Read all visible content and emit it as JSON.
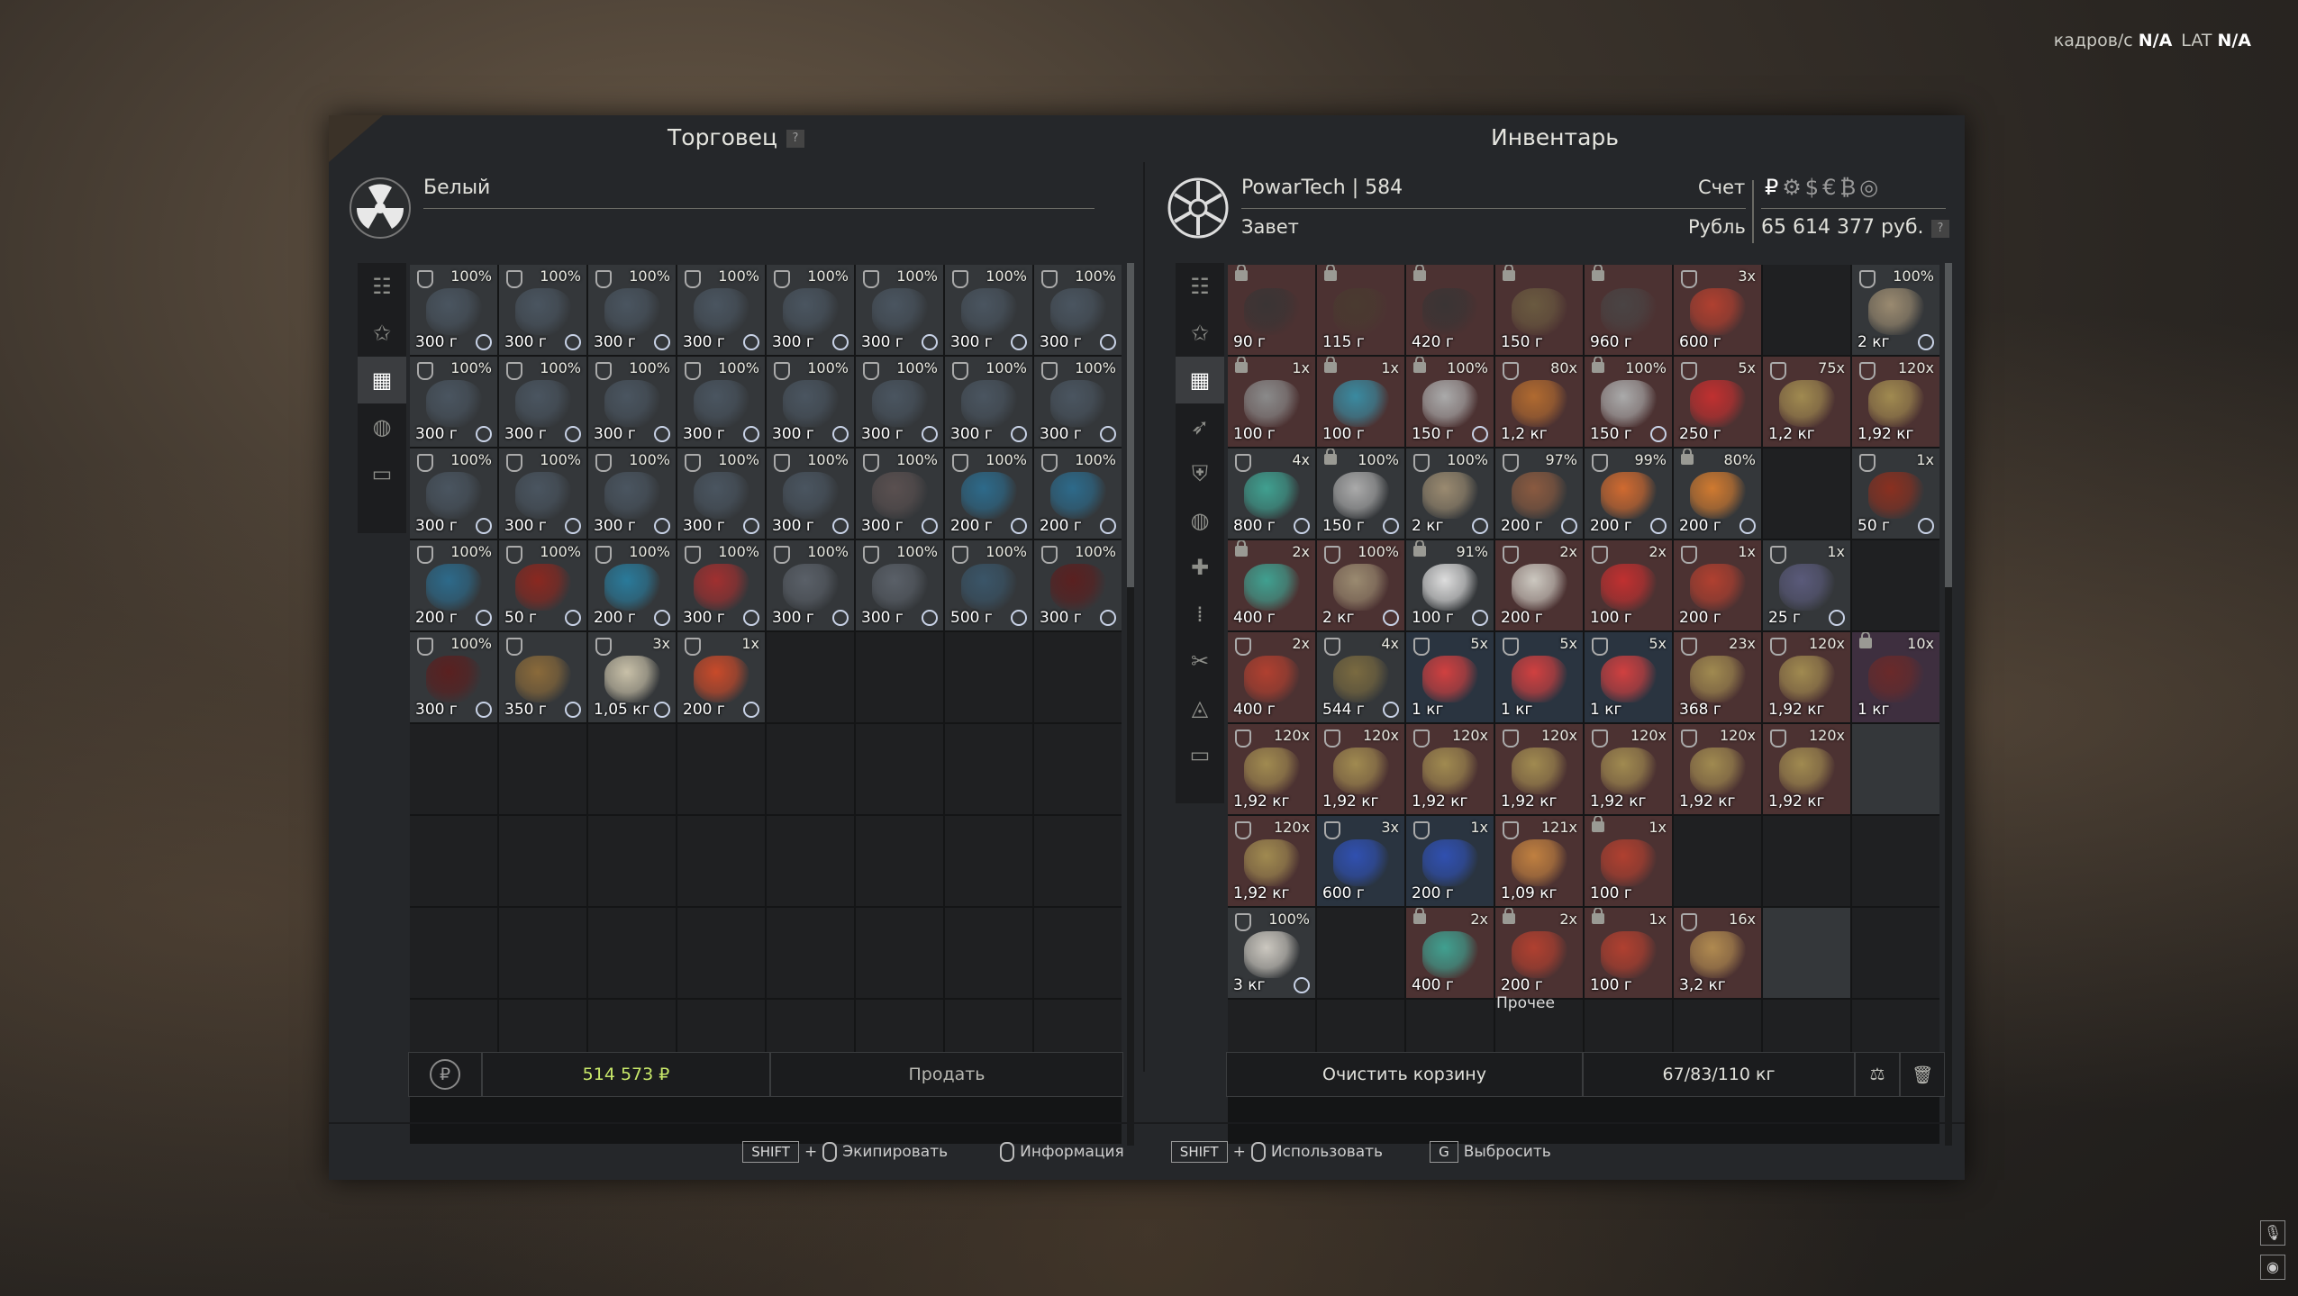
{
  "hud": {
    "fps_label": "кадров/с",
    "fps_value": "N/A",
    "lat_label": "LAT",
    "lat_value": "N/A"
  },
  "trader_panel": {
    "title": "Торговец",
    "help": "?",
    "trader_name": "Белый",
    "price_total": "514 573 ₽",
    "sell_label": "Продать"
  },
  "inventory_panel": {
    "title": "Инвентарь",
    "player": "PowarTech | 584",
    "faction": "Завет",
    "account_label": "Счет",
    "currency_name": "Рубль",
    "balance": "65 614 377 руб.",
    "help": "?",
    "clear_cart_label": "Очистить корзину",
    "weight": "67/83/110 кг",
    "misc_label": "Прочее"
  },
  "footer": {
    "equip_key": "SHIFT",
    "equip_label": "Экипировать",
    "info_label": "Информация",
    "use_key": "SHIFT",
    "use_label": "Использовать",
    "drop_key": "G",
    "drop_label": "Выбросить",
    "plus": "+"
  },
  "trader_items": [
    {
      "p": "100%",
      "w": "300 г",
      "c": "it",
      "col": "#4a5560"
    },
    {
      "p": "100%",
      "w": "300 г",
      "c": "it",
      "col": "#4a5560"
    },
    {
      "p": "100%",
      "w": "300 г",
      "c": "it",
      "col": "#4a5560"
    },
    {
      "p": "100%",
      "w": "300 г",
      "c": "it",
      "col": "#4a5560"
    },
    {
      "p": "100%",
      "w": "300 г",
      "c": "it",
      "col": "#4a5560"
    },
    {
      "p": "100%",
      "w": "300 г",
      "c": "it",
      "col": "#4a5560"
    },
    {
      "p": "100%",
      "w": "300 г",
      "c": "it",
      "col": "#4a5560"
    },
    {
      "p": "100%",
      "w": "300 г",
      "c": "it",
      "col": "#4a5560"
    },
    {
      "p": "100%",
      "w": "300 г",
      "c": "it",
      "col": "#4a5560"
    },
    {
      "p": "100%",
      "w": "300 г",
      "c": "it",
      "col": "#4a5560"
    },
    {
      "p": "100%",
      "w": "300 г",
      "c": "it",
      "col": "#4a5560"
    },
    {
      "p": "100%",
      "w": "300 г",
      "c": "it",
      "col": "#4a5560"
    },
    {
      "p": "100%",
      "w": "300 г",
      "c": "it",
      "col": "#4a5560"
    },
    {
      "p": "100%",
      "w": "300 г",
      "c": "it",
      "col": "#4a5560"
    },
    {
      "p": "100%",
      "w": "300 г",
      "c": "it",
      "col": "#4a5560"
    },
    {
      "p": "100%",
      "w": "300 г",
      "c": "it",
      "col": "#4a5560"
    },
    {
      "p": "100%",
      "w": "300 г",
      "c": "it",
      "col": "#4a5560"
    },
    {
      "p": "100%",
      "w": "300 г",
      "c": "it",
      "col": "#4a5560"
    },
    {
      "p": "100%",
      "w": "300 г",
      "c": "it",
      "col": "#4a5560"
    },
    {
      "p": "100%",
      "w": "300 г",
      "c": "it",
      "col": "#4a5560"
    },
    {
      "p": "100%",
      "w": "300 г",
      "c": "it",
      "col": "#4a5560"
    },
    {
      "p": "100%",
      "w": "300 г",
      "c": "it",
      "col": "#5a5050"
    },
    {
      "p": "100%",
      "w": "200 г",
      "c": "it",
      "col": "#2d6a8a"
    },
    {
      "p": "100%",
      "w": "200 г",
      "c": "it",
      "col": "#2d6a8a"
    },
    {
      "p": "100%",
      "w": "200 г",
      "c": "it",
      "col": "#2d6a8a"
    },
    {
      "p": "100%",
      "w": "50 г",
      "c": "it",
      "col": "#8a2820"
    },
    {
      "p": "100%",
      "w": "200 г",
      "c": "it",
      "col": "#2a7a9a"
    },
    {
      "p": "100%",
      "w": "300 г",
      "c": "it",
      "col": "#a03030"
    },
    {
      "p": "100%",
      "w": "300 г",
      "c": "it",
      "col": "#5a6068"
    },
    {
      "p": "100%",
      "w": "300 г",
      "c": "it",
      "col": "#5a6068"
    },
    {
      "p": "100%",
      "w": "500 г",
      "c": "it",
      "col": "#3a5568"
    },
    {
      "p": "100%",
      "w": "300 г",
      "c": "it",
      "col": "#5a2020"
    },
    {
      "p": "100%",
      "w": "300 г",
      "c": "it",
      "col": "#5a2020"
    },
    {
      "p": "",
      "w": "350 г",
      "c": "it",
      "col": "#8a6a3a"
    },
    {
      "p": "3x",
      "w": "1,05 кг",
      "c": "it",
      "col": "#c8c0a8"
    },
    {
      "p": "1x",
      "w": "200 г",
      "c": "it",
      "col": "#c84a2a"
    }
  ],
  "inventory_items": [
    {
      "p": "",
      "w": "90 г",
      "c": "red",
      "col": "#3a3434",
      "lock": true
    },
    {
      "p": "",
      "w": "115 г",
      "c": "red",
      "col": "#4a3a30",
      "lock": true
    },
    {
      "p": "",
      "w": "420 г",
      "c": "red",
      "col": "#3a3434",
      "lock": true
    },
    {
      "p": "",
      "w": "150 г",
      "c": "red",
      "col": "#6a5a40",
      "lock": true
    },
    {
      "p": "",
      "w": "960 г",
      "c": "red",
      "col": "#4a4444",
      "lock": true
    },
    {
      "p": "3x",
      "w": "600 г",
      "c": "red",
      "col": "#b04030"
    },
    {
      "p": "",
      "w": "",
      "c": "empty",
      "col": ""
    },
    {
      "p": "100%",
      "w": "2 кг",
      "c": "it",
      "col": "#9a8a70"
    },
    {
      "p": "1x",
      "w": "100 г",
      "c": "red",
      "col": "#8a8a8a",
      "lock": true
    },
    {
      "p": "1x",
      "w": "100 г",
      "c": "red",
      "col": "#3a8aa0",
      "lock": true
    },
    {
      "p": "100%",
      "w": "150 г",
      "c": "red",
      "col": "#aaaaaa",
      "lock": true
    },
    {
      "p": "80x",
      "w": "1,2 кг",
      "c": "red",
      "col": "#b06a30"
    },
    {
      "p": "100%",
      "w": "150 г",
      "c": "red",
      "col": "#aaaaaa",
      "lock": true
    },
    {
      "p": "5x",
      "w": "250 г",
      "c": "red",
      "col": "#c03030"
    },
    {
      "p": "75x",
      "w": "1,2 кг",
      "c": "red",
      "col": "#a08a50"
    },
    {
      "p": "120x",
      "w": "1,92 кг",
      "c": "red",
      "col": "#a08a50"
    },
    {
      "p": "4x",
      "w": "800 г",
      "c": "it",
      "col": "#40a090"
    },
    {
      "p": "100%",
      "w": "150 г",
      "c": "it",
      "col": "#aaaaaa",
      "lock": true
    },
    {
      "p": "100%",
      "w": "2 кг",
      "c": "it",
      "col": "#9a8a70"
    },
    {
      "p": "97%",
      "w": "200 г",
      "c": "it",
      "col": "#8a5a40"
    },
    {
      "p": "99%",
      "w": "200 г",
      "c": "it",
      "col": "#d06a30"
    },
    {
      "p": "80%",
      "w": "200 г",
      "c": "it",
      "col": "#d07a30",
      "lock": true
    },
    {
      "p": "",
      "w": "",
      "c": "empty",
      "col": ""
    },
    {
      "p": "1x",
      "w": "50 г",
      "c": "it",
      "col": "#8a3020"
    },
    {
      "p": "2x",
      "w": "400 г",
      "c": "red",
      "col": "#40a090",
      "lock": true
    },
    {
      "p": "100%",
      "w": "2 кг",
      "c": "red",
      "col": "#9a8a70"
    },
    {
      "p": "91%",
      "w": "100 г",
      "c": "it",
      "col": "#dddddd",
      "lock": true
    },
    {
      "p": "2x",
      "w": "200 г",
      "c": "red",
      "col": "#ccc8c0"
    },
    {
      "p": "2x",
      "w": "100 г",
      "c": "red",
      "col": "#c03030"
    },
    {
      "p": "1x",
      "w": "200 г",
      "c": "red",
      "col": "#b04030"
    },
    {
      "p": "1x",
      "w": "25 г",
      "c": "it",
      "col": "#5a5a7a"
    },
    {
      "p": "",
      "w": "",
      "c": "empty",
      "col": ""
    },
    {
      "p": "2x",
      "w": "400 г",
      "c": "red",
      "col": "#b04030"
    },
    {
      "p": "4x",
      "w": "544 г",
      "c": "it",
      "col": "#7a6a40"
    },
    {
      "p": "5x",
      "w": "1 кг",
      "c": "blu",
      "col": "#d04040"
    },
    {
      "p": "5x",
      "w": "1 кг",
      "c": "blu",
      "col": "#d04040"
    },
    {
      "p": "5x",
      "w": "1 кг",
      "c": "blu",
      "col": "#d04040"
    },
    {
      "p": "23x",
      "w": "368 г",
      "c": "red",
      "col": "#a08a50"
    },
    {
      "p": "120x",
      "w": "1,92 кг",
      "c": "red",
      "col": "#a08a50"
    },
    {
      "p": "10x",
      "w": "1 кг",
      "c": "pur",
      "col": "#6a2a2a",
      "lock": true
    },
    {
      "p": "120x",
      "w": "1,92 кг",
      "c": "red",
      "col": "#a08a50"
    },
    {
      "p": "120x",
      "w": "1,92 кг",
      "c": "red",
      "col": "#a08a50"
    },
    {
      "p": "120x",
      "w": "1,92 кг",
      "c": "red",
      "col": "#a08a50"
    },
    {
      "p": "120x",
      "w": "1,92 кг",
      "c": "red",
      "col": "#a08a50"
    },
    {
      "p": "120x",
      "w": "1,92 кг",
      "c": "red",
      "col": "#a08a50"
    },
    {
      "p": "120x",
      "w": "1,92 кг",
      "c": "red",
      "col": "#a08a50"
    },
    {
      "p": "120x",
      "w": "1,92 кг",
      "c": "red",
      "col": "#a08a50"
    },
    {
      "p": "",
      "w": "",
      "c": "skip",
      "col": ""
    },
    {
      "p": "120x",
      "w": "1,92 кг",
      "c": "red",
      "col": "#a08a50"
    },
    {
      "p": "3x",
      "w": "600 г",
      "c": "blu",
      "col": "#3050b0"
    },
    {
      "p": "1x",
      "w": "200 г",
      "c": "blu",
      "col": "#3050b0"
    },
    {
      "p": "121x",
      "w": "1,09 кг",
      "c": "red",
      "col": "#c08040"
    },
    {
      "p": "1x",
      "w": "100 г",
      "c": "red",
      "col": "#b04030",
      "lock": true
    },
    {
      "p": "",
      "w": "",
      "c": "empty",
      "col": ""
    },
    {
      "p": "",
      "w": "",
      "c": "empty",
      "col": ""
    },
    {
      "p": "",
      "w": "",
      "c": "empty",
      "col": ""
    },
    {
      "p": "100%",
      "w": "3 кг",
      "c": "it",
      "col": "#ccc8c0"
    },
    {
      "p": "",
      "w": "",
      "c": "empty",
      "col": ""
    },
    {
      "p": "2x",
      "w": "400 г",
      "c": "red",
      "col": "#40a090",
      "lock": true
    },
    {
      "p": "2x",
      "w": "200 г",
      "c": "red",
      "col": "#b04030",
      "lock": true
    },
    {
      "p": "1x",
      "w": "100 г",
      "c": "red",
      "col": "#b04030",
      "lock": true
    },
    {
      "p": "16x",
      "w": "3,2 кг",
      "c": "red",
      "col": "#b08a50"
    },
    {
      "p": "",
      "w": "",
      "c": "skip",
      "col": ""
    },
    {
      "p": "",
      "w": "",
      "c": "empty",
      "col": ""
    }
  ]
}
